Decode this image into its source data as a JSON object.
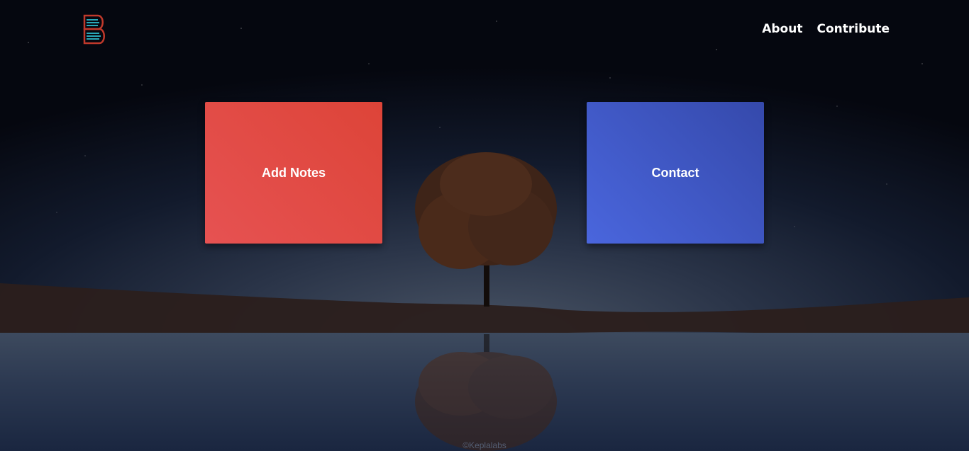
{
  "header": {
    "logo_icon": "book-stack-logo-icon",
    "nav": [
      {
        "label": "About"
      },
      {
        "label": "Contribute"
      }
    ]
  },
  "cards": {
    "add_notes": {
      "label": "Add Notes",
      "color": "#e04a44"
    },
    "contact": {
      "label": "Contact",
      "color": "#3f59c4"
    }
  },
  "footer": {
    "copyright": "©Keplalabs"
  },
  "colors": {
    "background": "#0b1122",
    "nav_text": "#ffffff"
  }
}
